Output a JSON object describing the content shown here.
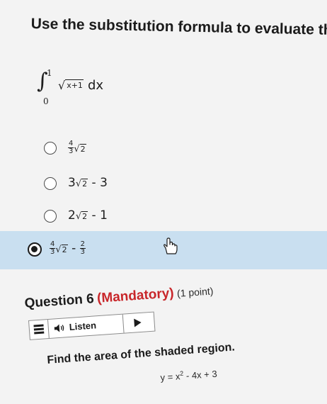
{
  "question5": {
    "instruction": "Use the substitution formula to evaluate th",
    "integral": {
      "sign": "∫",
      "upper": "1",
      "lower": "0",
      "radicand": "x+1",
      "differential": "dx"
    },
    "options": [
      {
        "id": "a",
        "coef_num": "4",
        "coef_den": "3",
        "sqrt_of": "2",
        "suffix": "",
        "selected": false
      },
      {
        "id": "b",
        "prefix": "3",
        "sqrt_of": "2",
        "suffix": "- 3",
        "selected": false
      },
      {
        "id": "c",
        "prefix": "2",
        "sqrt_of": "2",
        "suffix": "- 1",
        "selected": false
      },
      {
        "id": "d",
        "coef_num": "4",
        "coef_den": "3",
        "sqrt_of": "2",
        "minus": "-",
        "tail_num": "2",
        "tail_den": "3",
        "selected": true
      }
    ],
    "selected_bg": "#c9dff0"
  },
  "question6": {
    "title": "Question 6",
    "mandatory": "(Mandatory)",
    "points": "(1 point)",
    "mandatory_color": "#c8262a",
    "listen_label": "Listen",
    "prompt": "Find the area of the shaded region.",
    "equation_lhs": "y = x",
    "equation_exp": "2",
    "equation_rhs": " - 4x + 3"
  }
}
